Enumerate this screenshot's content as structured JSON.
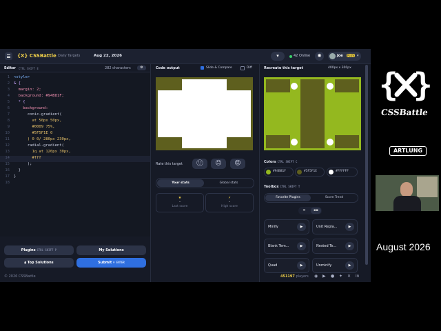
{
  "app": {
    "brand": "{X} CSSBattle",
    "breadcrumb_section": "Daily Targets",
    "breadcrumb_current": "Aug 22, 2026",
    "online": "42 Online",
    "user_name": "Joe",
    "user_badge": "PLUS"
  },
  "editor": {
    "title": "Editor",
    "shortcut": "CTRL SHIFT E",
    "chars": "282 characters",
    "lines": [
      "<style>",
      "& {",
      "  margin: 2;",
      "  background: #94B81F;",
      "  * {",
      "    background:",
      "      conic-gradient(",
      "        at 50px 50px,",
      "        #0009 75%,",
      "        #5F5F1E 0",
      "      ) 0 0/ 280px 230px,",
      "      radial-gradient(",
      "        1q at 120px 30px,",
      "        #fff",
      "      );",
      "  }",
      "}",
      ""
    ]
  },
  "buttons": {
    "plugins": "Plugins",
    "plugins_shortcut": "CTRL SHIFT P",
    "my_solutions": "My Solutions",
    "top_solutions": "Top Solutions",
    "submit": "Submit",
    "submit_shortcut": "⌘ ENTER"
  },
  "output": {
    "title": "Code output",
    "slide_compare": "Slide & Compare",
    "diff": "Diff",
    "rate": "Rate this target",
    "tab_your": "Your stats",
    "tab_global": "Global stats",
    "last_score_value": "-",
    "last_score_label": "Last score",
    "high_score_value": "-",
    "high_score_label": "High score"
  },
  "target": {
    "title": "Recreate this target",
    "size": "400px x 300px",
    "colors_title": "Colors",
    "colors_shortcut": "CTRL SHIFT C",
    "colors": [
      {
        "hex": "#94B81F",
        "value": "#94b81f"
      },
      {
        "hex": "#5F5F1E",
        "value": "#5f5f1e"
      },
      {
        "hex": "#FFFFFF",
        "value": "#ffffff"
      }
    ],
    "toolbox_title": "Toolbox",
    "toolbox_shortcut": "CTRL SHIFT T",
    "tab_fav": "Favorite Plugins",
    "tab_trend": "Score Trend",
    "plugins": [
      "Minify",
      "Unit Repla...",
      "Blank Tem...",
      "Nested Te...",
      "Quad",
      "Unminify"
    ]
  },
  "footer": {
    "copyright": "© 2026 CSSBattle",
    "players_count": "451197",
    "players_label": "players"
  },
  "side": {
    "css_battle": "CSSBattle",
    "artlung": "ARTLUNG",
    "month": "August 2026"
  }
}
